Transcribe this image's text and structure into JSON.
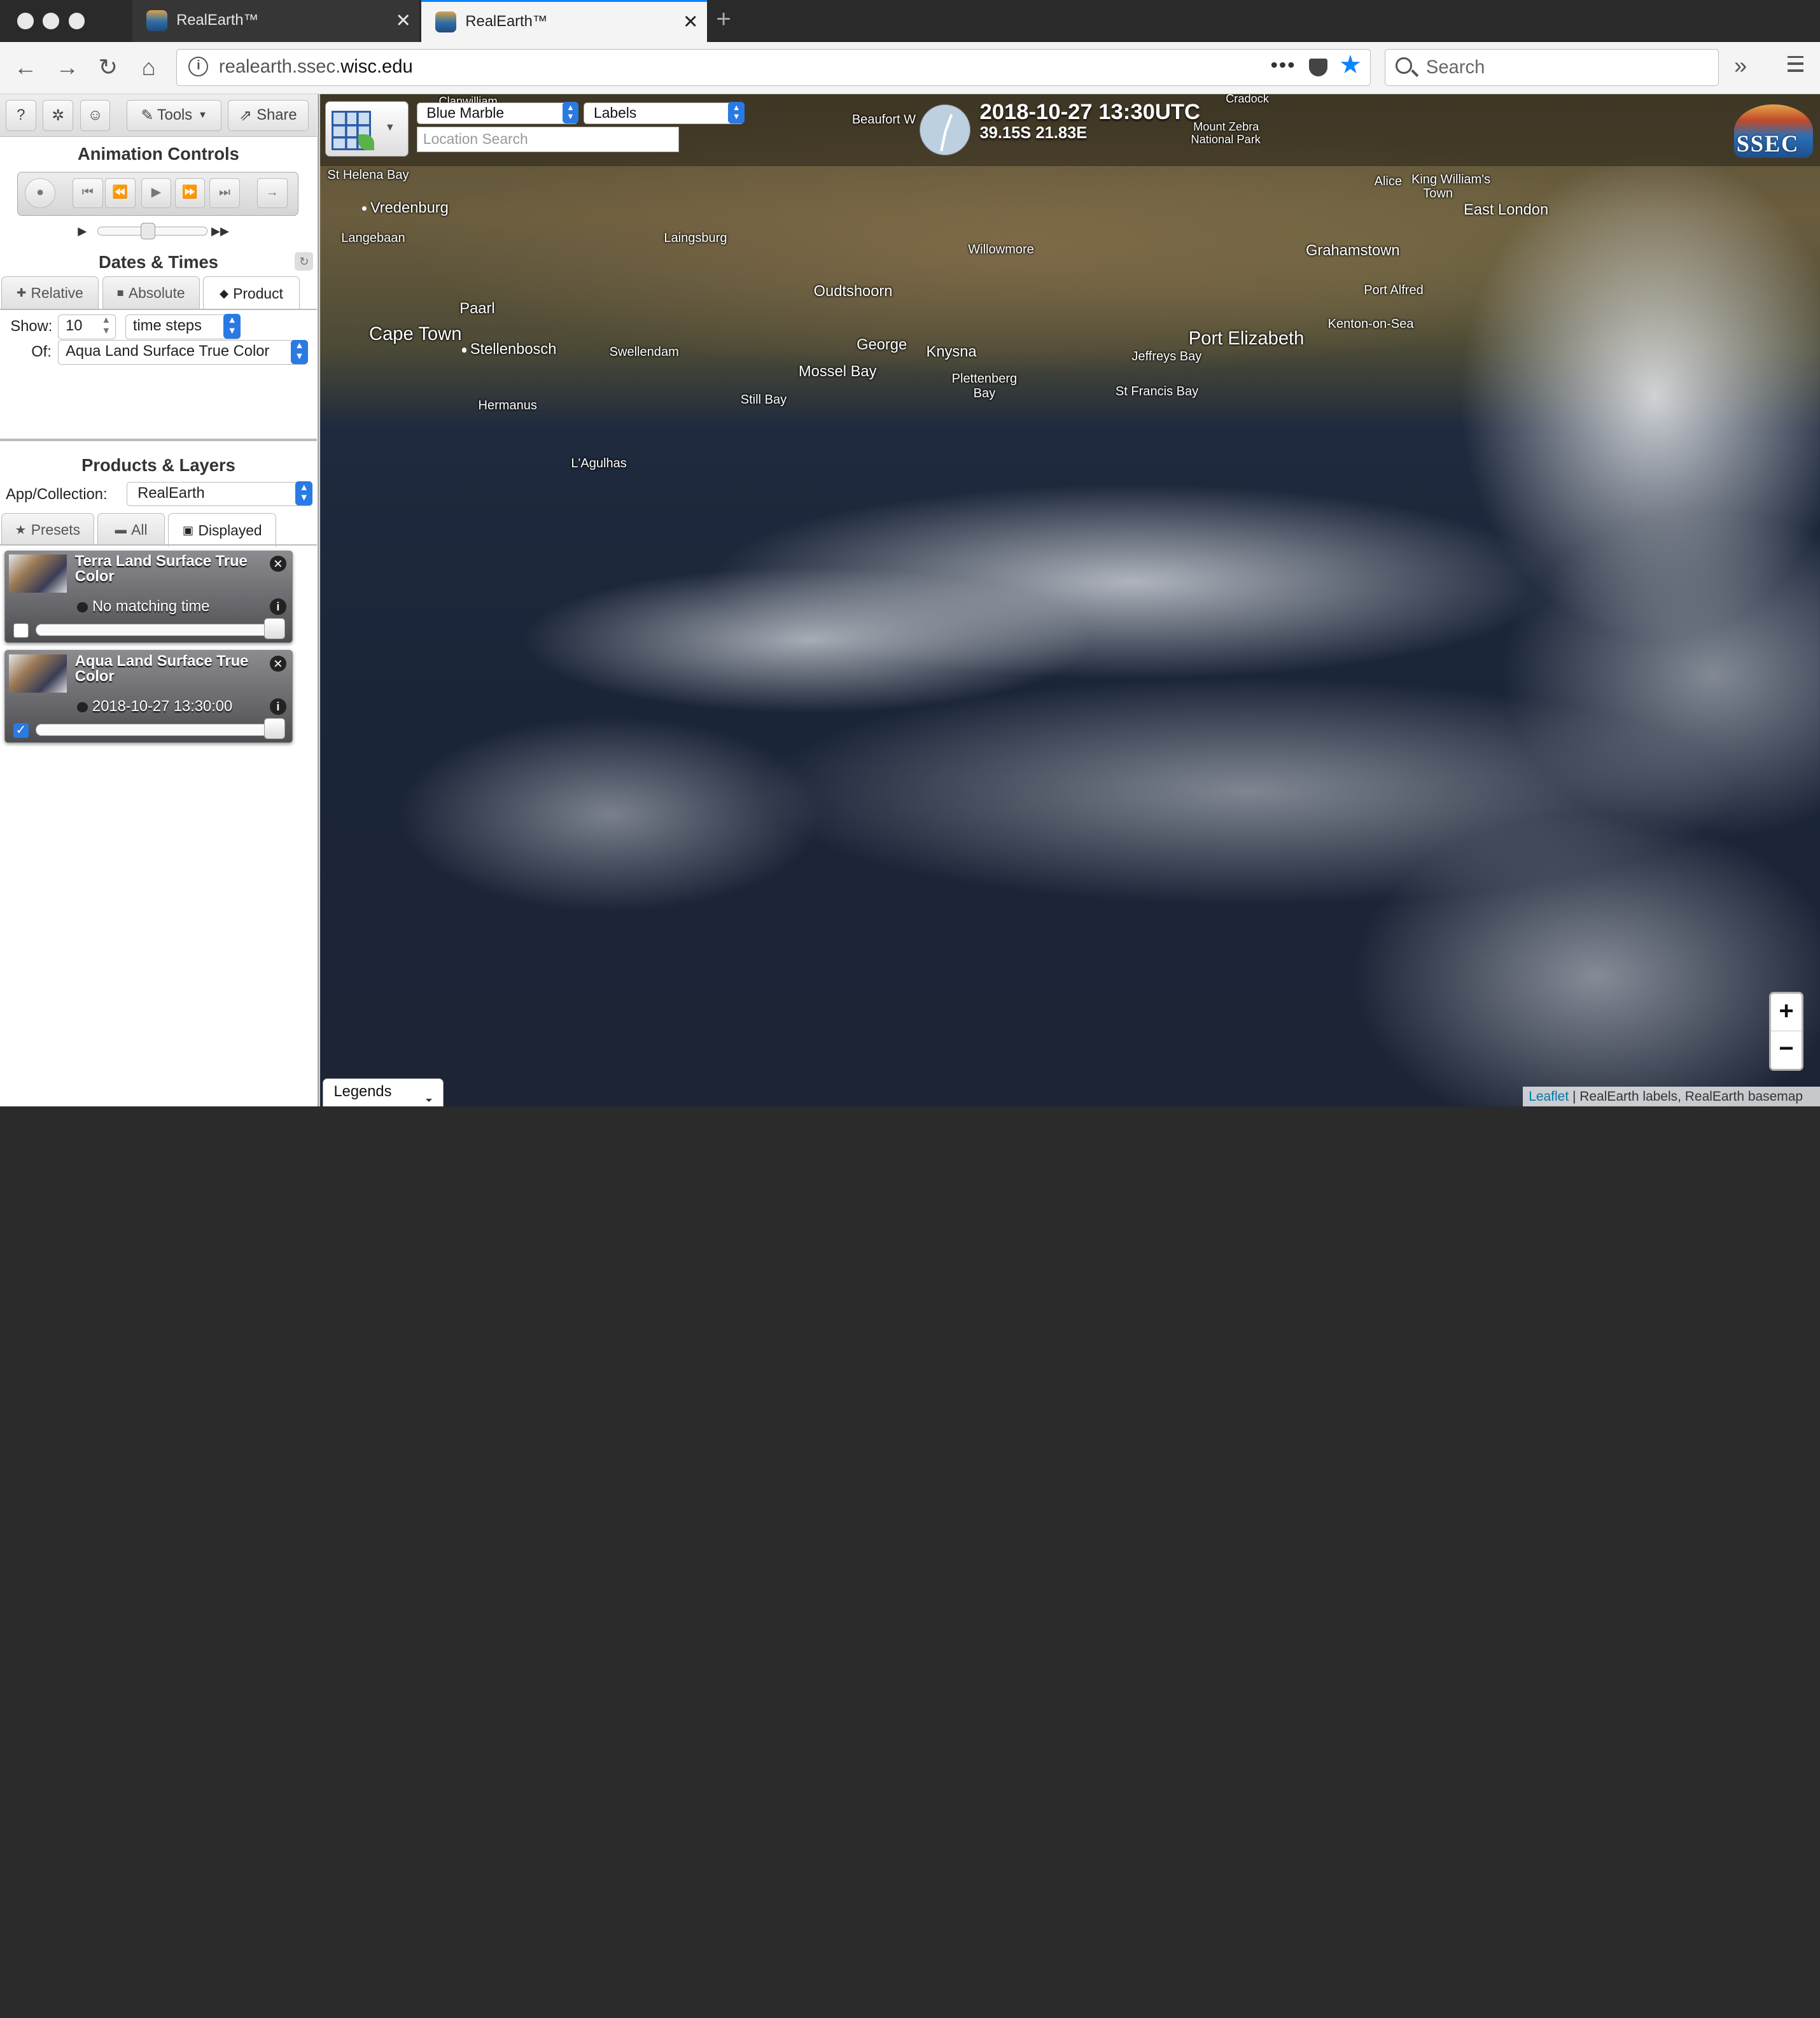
{
  "browser": {
    "tabs": [
      {
        "label": "RealEarth™"
      },
      {
        "label": "RealEarth™"
      }
    ],
    "url_prefix": "realearth.ssec.",
    "url_domain": "wisc.edu",
    "search_placeholder": "Search"
  },
  "sidebar": {
    "toolbar": {
      "help": "?",
      "tools": "Tools",
      "share": "Share"
    },
    "animation": {
      "title": "Animation Controls"
    },
    "dates": {
      "title": "Dates & Times",
      "tabs": [
        "Relative",
        "Absolute",
        "Product"
      ],
      "show_label": "Show:",
      "show_value": "10",
      "unit_value": "time steps",
      "of_label": "Of:",
      "of_value": "Aqua Land Surface True Color"
    },
    "products": {
      "title": "Products & Layers",
      "collection_label": "App/Collection:",
      "collection_value": "RealEarth",
      "tabs": [
        "Presets",
        "All",
        "Displayed"
      ]
    },
    "layers": [
      {
        "title": "Terra Land Surface True Color",
        "time": "No matching time",
        "checked": false
      },
      {
        "title": "Aqua Land Surface True Color",
        "time": "2018-10-27 13:30:00",
        "checked": true
      }
    ]
  },
  "map": {
    "basemap": "Blue Marble",
    "overlay": "Labels",
    "location_placeholder": "Location Search",
    "datetime": "2018-10-27 13:30UTC",
    "coords": "39.15S 21.83E",
    "logo": "SSEC",
    "legends": "Legends",
    "attribution_link": "Leaflet",
    "attribution_text": "| RealEarth labels, RealEarth basemap",
    "places": {
      "clanwilliam": "Clanwilliam",
      "beaufort": "Beaufort W",
      "cradock": "Cradock",
      "mountzebra": "Mount Zebra",
      "natpark": "National Park",
      "sthelena": "St Helena Bay",
      "vredenburg": "Vredenburg",
      "langebaan": "Langebaan",
      "laingsburg": "Laingsburg",
      "willowmore": "Willowmore",
      "alice": "Alice",
      "kingwilliams": "King William's",
      "town": "Town",
      "eastlondon": "East London",
      "grahamstown": "Grahamstown",
      "portalfred": "Port Alfred",
      "kenton": "Kenton-on-Sea",
      "oudtshoorn": "Oudtshoorn",
      "paarl": "Paarl",
      "capetown": "Cape Town",
      "stellenbosch": "Stellenbosch",
      "swellendam": "Swellendam",
      "george": "George",
      "knysna": "Knysna",
      "mosselbay": "Mossel Bay",
      "plettenberg": "Plettenberg",
      "bay": "Bay",
      "jeffreys": "Jeffreys Bay",
      "stfrancis": "St Francis Bay",
      "portelizabeth": "Port Elizabeth",
      "hermanus": "Hermanus",
      "stillbay": "Still Bay",
      "agulhas": "L'Agulhas"
    }
  }
}
